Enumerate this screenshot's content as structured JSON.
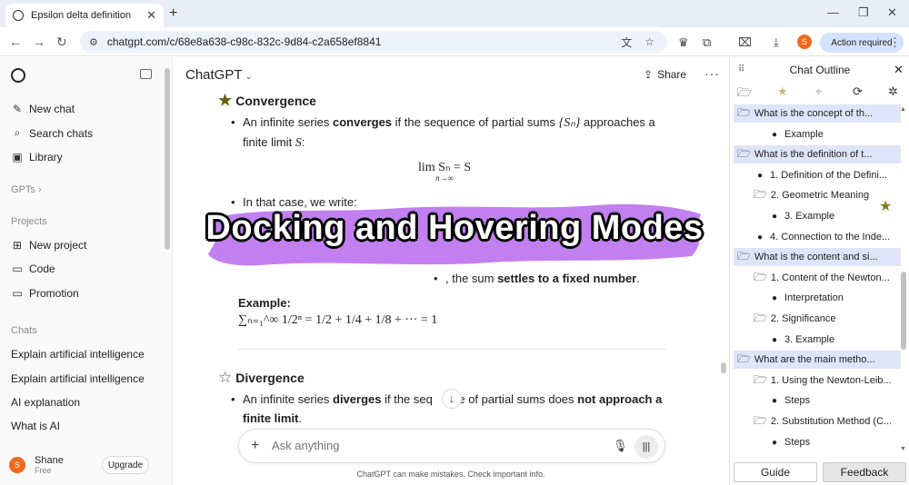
{
  "browser": {
    "tab_title": "Epsilon delta definition",
    "url": "chatgpt.com/c/68e8a638-c98c-832c-9d84-c2a658ef8841",
    "profile_initial": "S",
    "action_required": "Action required"
  },
  "sidebar": {
    "new_chat": "New chat",
    "search_chats": "Search chats",
    "library": "Library",
    "gpts": "GPTs ›",
    "projects_header": "Projects",
    "projects": [
      "New project",
      "Code",
      "Promotion"
    ],
    "chats_header": "Chats",
    "chats": [
      "Explain artificial intelligence",
      "Explain artificial intelligence",
      "AI explanation",
      "What is AI"
    ],
    "user_name": "Shane",
    "user_plan": "Free",
    "user_initial": "S",
    "upgrade": "Upgrade"
  },
  "main": {
    "title": "ChatGPT",
    "share": "Share",
    "convergence_heading": "Convergence",
    "conv_line1_a": "An infinite series ",
    "conv_line1_b": "converges",
    "conv_line1_c": " if the sequence of partial sums ",
    "conv_line1_math": "{Sₙ}",
    "conv_line1_d": " approaches a",
    "conv_line2": "finite limit ",
    "conv_line2_math": "S",
    "conv_line2_end": ":",
    "display_math": "lim Sₙ = S",
    "display_sub": "n→∞",
    "in_that_case": "In that case, we write:",
    "settles_prefix": ", the sum ",
    "settles_bold": "settles to a fixed number",
    "settles_end": ".",
    "example_label": "Example:",
    "example_formula": "∑ₙ₌₁^∞ 1/2ⁿ = 1/2 + 1/4 + 1/8 + ··· = 1",
    "divergence_heading": "Divergence",
    "div_line1_a": "An infinite series ",
    "div_line1_b": "diverges",
    "div_line1_c": " if the seq",
    "div_line1_d": "ce of partial sums does ",
    "div_line1_e": "not approach a",
    "div_line2": "finite limit",
    "div_line2_end": ".",
    "composer_placeholder": "Ask anything",
    "disclaimer": "ChatGPT can make mistakes. Check important info."
  },
  "banner": {
    "text": "Docking and Hovering Modes",
    "color": "#c27ff0"
  },
  "outline": {
    "title": "Chat Outline",
    "items": [
      {
        "kind": "q",
        "label": "What is the concept of th..."
      },
      {
        "kind": "dot",
        "label": "Example"
      },
      {
        "kind": "q",
        "label": "What is the definition of t..."
      },
      {
        "kind": "dot1",
        "label": "1. Definition of the Defini..."
      },
      {
        "kind": "folder",
        "label": "2. Geometric Meaning"
      },
      {
        "kind": "dot",
        "label": "3. Example"
      },
      {
        "kind": "dot1",
        "label": "4. Connection to the Inde..."
      },
      {
        "kind": "q",
        "label": "What is the content and si..."
      },
      {
        "kind": "folder",
        "label": "1. Content of the Newton..."
      },
      {
        "kind": "dot",
        "label": "Interpretation"
      },
      {
        "kind": "folder",
        "label": "2. Significance"
      },
      {
        "kind": "dot",
        "label": "3. Example"
      },
      {
        "kind": "q",
        "label": "What are the main metho..."
      },
      {
        "kind": "folder",
        "label": "1. Using the Newton-Leib..."
      },
      {
        "kind": "dot",
        "label": "Steps"
      },
      {
        "kind": "folder",
        "label": "2. Substitution Method (C..."
      },
      {
        "kind": "dot",
        "label": "Steps"
      }
    ],
    "guide": "Guide",
    "feedback": "Feedback"
  }
}
